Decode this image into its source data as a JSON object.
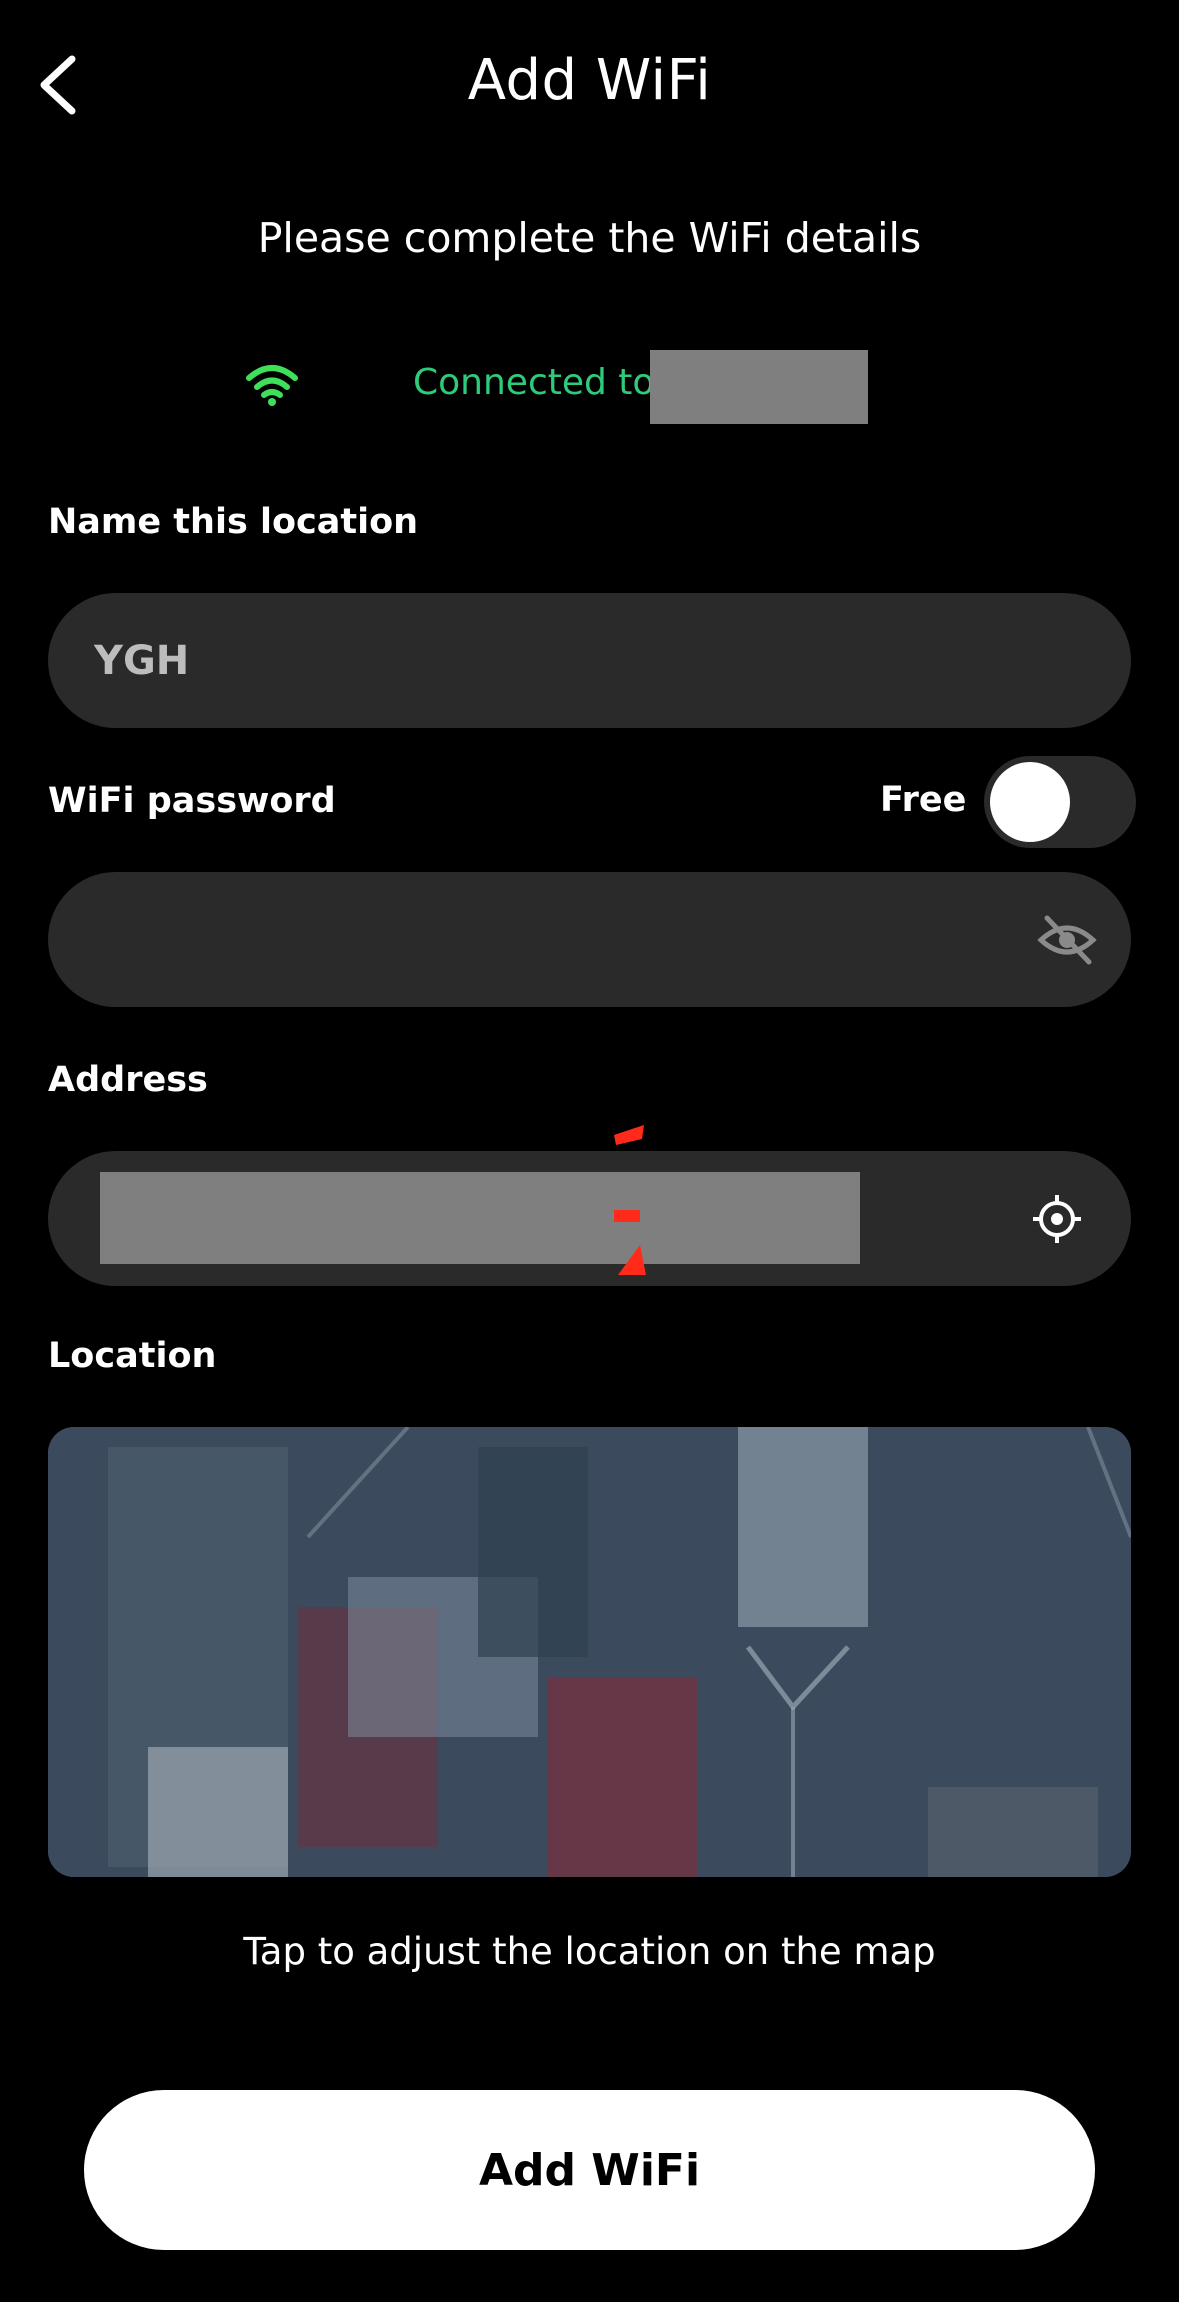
{
  "header": {
    "title": "Add WiFi",
    "back_icon": "chevron-left-icon"
  },
  "subtitle": "Please complete the WiFi details",
  "connection": {
    "icon": "wifi-icon",
    "text": "Connected to",
    "color": "#2ecc7a"
  },
  "form": {
    "location_name": {
      "label": "Name this location",
      "value": "YGH"
    },
    "password": {
      "label": "WiFi password",
      "value": "",
      "free_label": "Free",
      "free_enabled": false,
      "visibility_icon": "eye-off-icon"
    },
    "address": {
      "label": "Address",
      "locate_icon": "crosshair-target-icon"
    },
    "location": {
      "label": "Location",
      "caption": "Tap to adjust the location on the map"
    }
  },
  "actions": {
    "submit_label": "Add WiFi"
  },
  "colors": {
    "background": "#000000",
    "field": "#2a2a2a",
    "accent_green": "#2ecc7a",
    "button": "#ffffff"
  }
}
